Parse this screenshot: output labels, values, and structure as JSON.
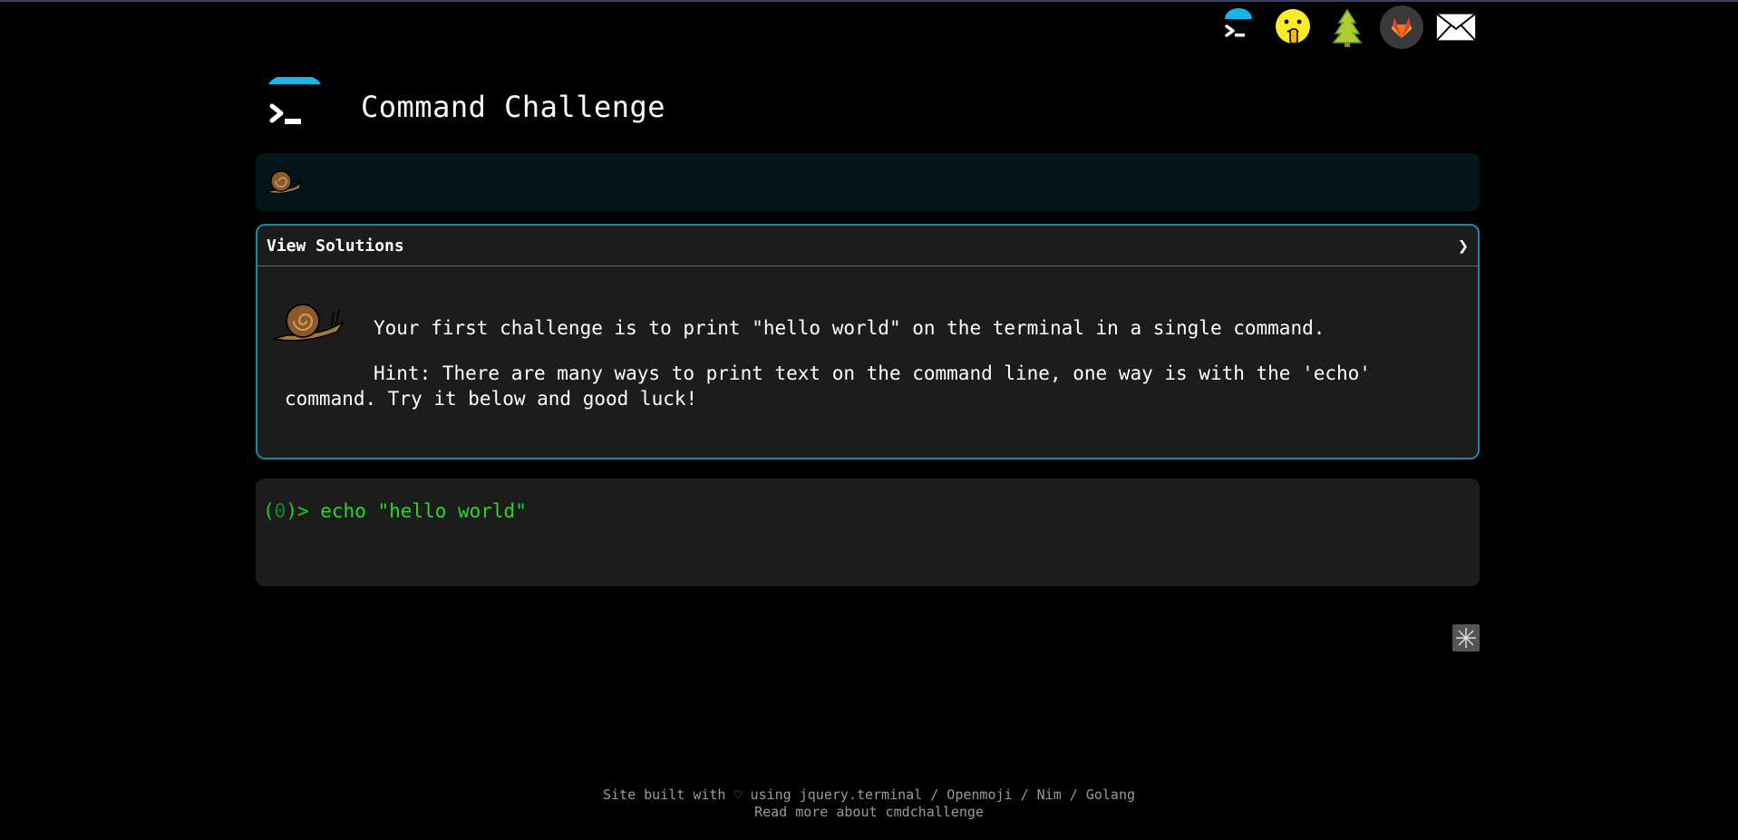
{
  "app": {
    "title": "Command Challenge"
  },
  "top_nav": {
    "icons": [
      "terminal-icon",
      "shush-face-icon",
      "tree-icon",
      "gitlab-icon",
      "mail-icon"
    ]
  },
  "challenge": {
    "header_label": "View Solutions",
    "chevron": "❯",
    "line1": "Your first challenge is to print \"hello world\" on the terminal in a single command.",
    "line2": "Hint: There are many ways to print text on the command line, one way is with the 'echo'",
    "line3": "command. Try it below and good luck!"
  },
  "terminal": {
    "prompt_open": "(",
    "prompt_number": "0",
    "prompt_close": ")>",
    "command": "echo \"hello world\""
  },
  "footer": {
    "line1_prefix": "Site built with ♡ using ",
    "link_jquery": "jquery.terminal",
    "sep1": " / ",
    "link_openmoji": "Openmoji",
    "sep2": " / ",
    "link_nim": "Nim",
    "sep3": " / ",
    "link_golang": "Golang",
    "line2": "Read more about cmdchallenge"
  },
  "colors": {
    "background": "#000000",
    "accent": "#1a87a8",
    "panel": "#1c1c1c",
    "progress_bg": "#03141a",
    "terminal_green": "#2bd62b"
  }
}
